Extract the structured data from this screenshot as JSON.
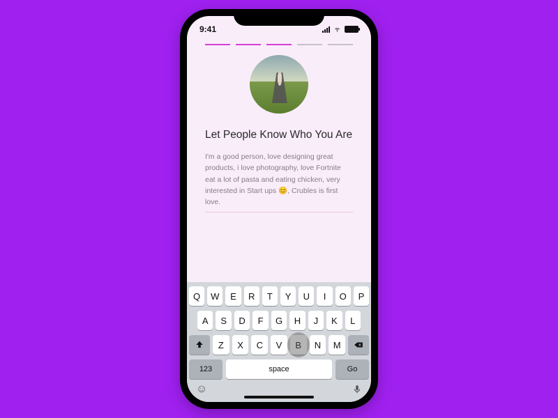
{
  "statusbar": {
    "time": "9:41"
  },
  "progress": {
    "steps": 5,
    "completed": 3
  },
  "content": {
    "heading": "Let People Know Who You Are",
    "bio": "I'm a good person, love designing great  products, i love photography, love Fortnite eat a lot of pasta and eating chicken, very interested in Start ups 😊, Crubles is first love."
  },
  "keyboard": {
    "row1": [
      "Q",
      "W",
      "E",
      "R",
      "T",
      "Y",
      "U",
      "I",
      "O",
      "P"
    ],
    "row2": [
      "A",
      "S",
      "D",
      "F",
      "G",
      "H",
      "J",
      "K",
      "L"
    ],
    "row3": [
      "Z",
      "X",
      "C",
      "V",
      "B",
      "N",
      "M"
    ],
    "num_label": "123",
    "space_label": "space",
    "go_label": "Go",
    "pressed_key": "B"
  },
  "colors": {
    "accent": "#d63fd6",
    "page_bg": "#a020f0",
    "screen_bg": "#f9edf9"
  }
}
